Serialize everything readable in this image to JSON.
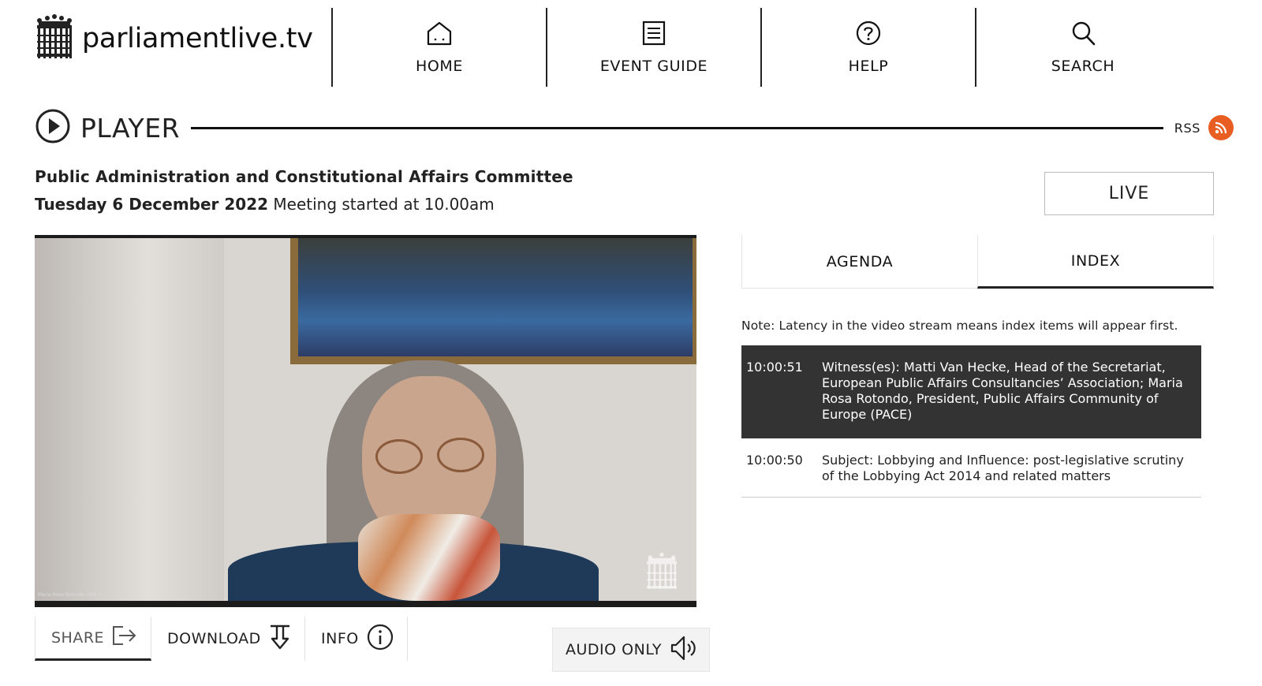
{
  "site": {
    "name": "parliamentlive.tv"
  },
  "nav": [
    {
      "label": "HOME",
      "icon": "home-icon"
    },
    {
      "label": "EVENT GUIDE",
      "icon": "document-icon"
    },
    {
      "label": "HELP",
      "icon": "help-icon"
    },
    {
      "label": "SEARCH",
      "icon": "search-icon"
    }
  ],
  "player": {
    "title": "PLAYER",
    "rss_label": "RSS"
  },
  "meeting": {
    "committee": "Public Administration and Constitutional Affairs Committee",
    "date": "Tuesday 6 December 2022",
    "started": "Meeting started at 10.00am",
    "live_label": "LIVE"
  },
  "video": {
    "caption": "Maria Rosa Rotondo (W8 1)"
  },
  "actions": {
    "share": "SHARE",
    "download": "DOWNLOAD",
    "info": "INFO",
    "audio_only": "AUDIO ONLY"
  },
  "panel": {
    "tabs": [
      {
        "label": "AGENDA",
        "active": false
      },
      {
        "label": "INDEX",
        "active": true
      }
    ],
    "note": "Note: Latency in the video stream means index items will appear first.",
    "index": [
      {
        "time": "10:00:51",
        "text": "Witness(es): Matti Van Hecke, Head of the Secretariat, European Public Affairs Consultancies’ Association; Maria Rosa Rotondo, President, Public Affairs Community of Europe (PACE)",
        "current": true
      },
      {
        "time": "10:00:50",
        "text": "Subject: Lobbying and Influence: post-legislative scrutiny of the Lobbying Act 2014 and related matters",
        "current": false
      }
    ]
  },
  "colors": {
    "rss": "#e85d22",
    "index_current_bg": "#333333"
  }
}
